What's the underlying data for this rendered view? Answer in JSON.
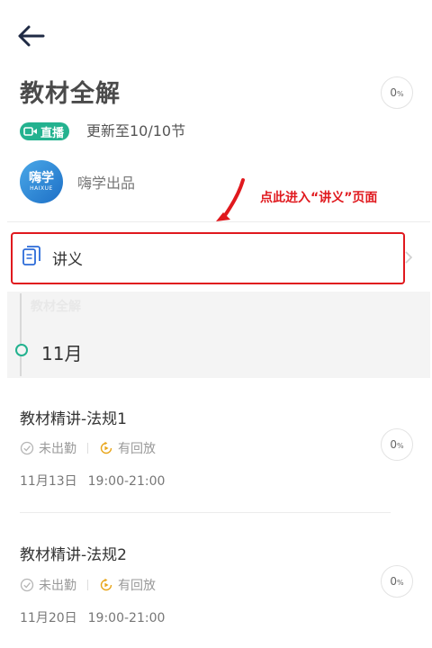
{
  "header": {
    "back_icon": "arrow-left-icon"
  },
  "course": {
    "title": "教材全解",
    "progress": {
      "value": "0",
      "unit": "%"
    },
    "live_badge": "直播",
    "update_text": "更新至10/10节"
  },
  "brand": {
    "logo_cn": "嗨学",
    "logo_en": "HAIXUE",
    "name": "嗨学出品"
  },
  "annotation": {
    "text": "点此进入“讲义”页面",
    "color": "#e0191e"
  },
  "handout": {
    "label": "讲义",
    "icon": "document-icon"
  },
  "timeline": {
    "faded_label": "教材全解",
    "month": "11月",
    "accent": "#23b28f"
  },
  "lessons": [
    {
      "title": "教材精讲-法规1",
      "attendance": "未出勤",
      "replay": "有回放",
      "date": "11月13日",
      "time": "19:00-21:00",
      "progress": {
        "value": "0",
        "unit": "%"
      }
    },
    {
      "title": "教材精讲-法规2",
      "attendance": "未出勤",
      "replay": "有回放",
      "date": "11月20日",
      "time": "19:00-21:00",
      "progress": {
        "value": "0",
        "unit": "%"
      }
    }
  ]
}
